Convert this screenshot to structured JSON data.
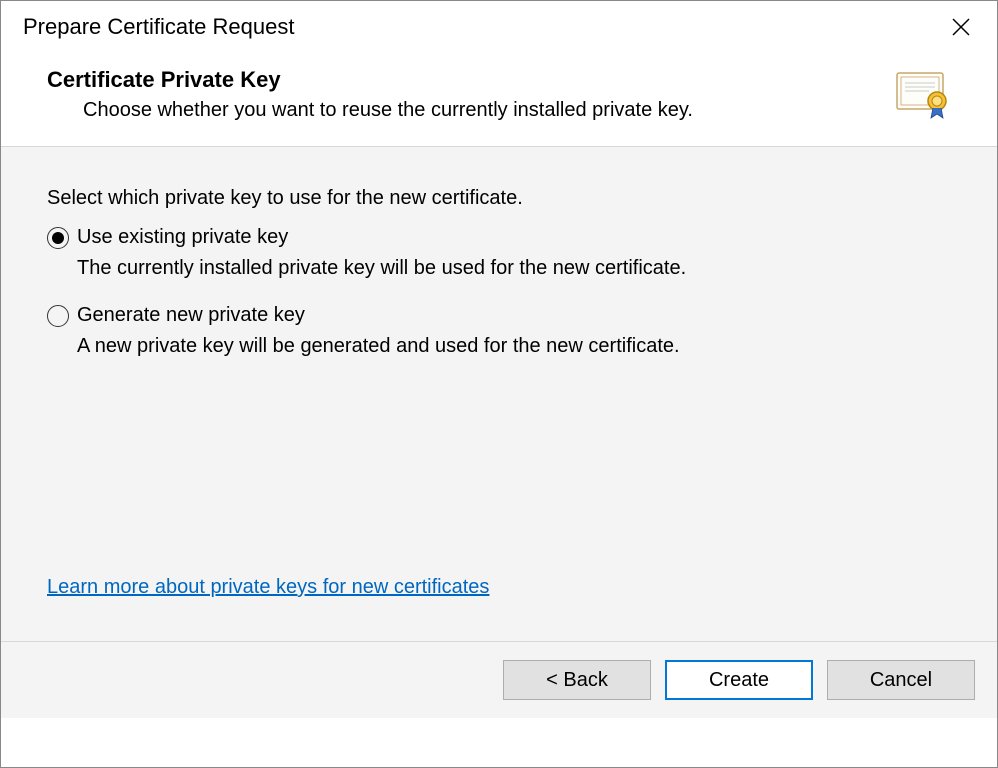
{
  "titlebar": {
    "title": "Prepare Certificate Request"
  },
  "header": {
    "title": "Certificate Private Key",
    "subtitle": "Choose whether you want to reuse the currently installed private key."
  },
  "content": {
    "instruction": "Select which private key to use for the new certificate.",
    "options": [
      {
        "label": "Use existing private key",
        "description": "The currently installed private key will be used for the new certificate.",
        "selected": true
      },
      {
        "label": "Generate new private key",
        "description": "A new private key will be generated and used for the new certificate.",
        "selected": false
      }
    ],
    "help_link": "Learn more about private keys for new certificates"
  },
  "footer": {
    "back": "< Back",
    "create": "Create",
    "cancel": "Cancel"
  }
}
